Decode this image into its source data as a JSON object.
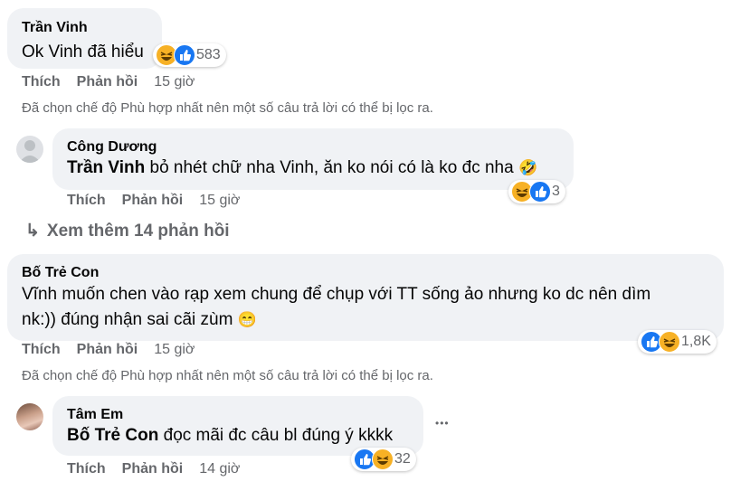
{
  "comments": [
    {
      "author": "Trần Vinh",
      "text": "Ok Vinh đã hiểu",
      "reaction_count": "583",
      "actions": {
        "like": "Thích",
        "reply": "Phản hồi",
        "time": "15 giờ"
      }
    },
    {
      "author": "Công Dương",
      "mention": "Trần Vinh",
      "text": " bỏ nhét chữ nha Vinh, ăn ko nói có là ko đc nha",
      "emoji": "🤣",
      "reaction_count": "3",
      "actions": {
        "like": "Thích",
        "reply": "Phản hồi",
        "time": "15 giờ"
      }
    },
    {
      "author": "Bố Trẻ Con",
      "text_line1": "Vĩnh muốn chen vào rạp xem chung để chụp với TT sống ảo nhưng ko dc nên dìm",
      "text_line2": "nk:)) đúng nhận sai cãi zùm",
      "emoji": "😁",
      "reaction_count": "1,8K",
      "actions": {
        "like": "Thích",
        "reply": "Phản hồi",
        "time": "15 giờ"
      }
    },
    {
      "author": "Tâm Em",
      "mention": "Bố Trẻ Con",
      "text": " đọc mãi đc câu bl đúng ý kkkk",
      "more": "•••",
      "reaction_count": "32",
      "actions": {
        "like": "Thích",
        "reply": "Phản hồi",
        "time": "14 giờ"
      }
    }
  ],
  "filter_notice": "Đã chọn chế độ Phù hợp nhất nên một số câu trả lời có thể bị lọc ra.",
  "view_more": {
    "arrow": "↳",
    "label": "Xem thêm 14 phản hồi"
  },
  "colors": {
    "bubble": "#f0f2f5",
    "secondary_text": "#65676b",
    "like_blue": "#1877f2",
    "haha_yellow": "#f7b125"
  }
}
